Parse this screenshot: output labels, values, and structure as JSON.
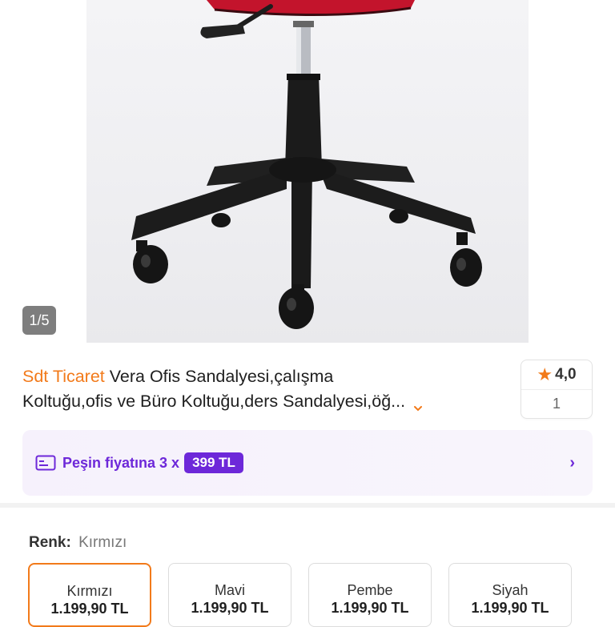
{
  "gallery": {
    "page_indicator": "1/5",
    "image_alt": "product-photo"
  },
  "product": {
    "brand": "Sdt Ticaret",
    "title_line1": "Vera Ofis Sandalyesi,çalışma",
    "title_line2": "Koltuğu,ofis ve Büro Koltuğu,ders Sandalyesi,öğ...",
    "rating": "4,0",
    "review_count": "1"
  },
  "installment": {
    "label": "Peşin fiyatına 3 x",
    "price": "399 TL"
  },
  "variants": {
    "label_key": "Renk:",
    "label_value": "Kırmızı",
    "items": [
      {
        "name": "Kırmızı",
        "price": "1.199,90 TL",
        "selected": true
      },
      {
        "name": "Mavi",
        "price": "1.199,90 TL",
        "selected": false
      },
      {
        "name": "Pembe",
        "price": "1.199,90 TL",
        "selected": false
      },
      {
        "name": "Siyah",
        "price": "1.199,90 TL",
        "selected": false
      }
    ]
  },
  "colors": {
    "brand_orange": "#f27a1a",
    "installment_purple": "#6d28d9"
  }
}
